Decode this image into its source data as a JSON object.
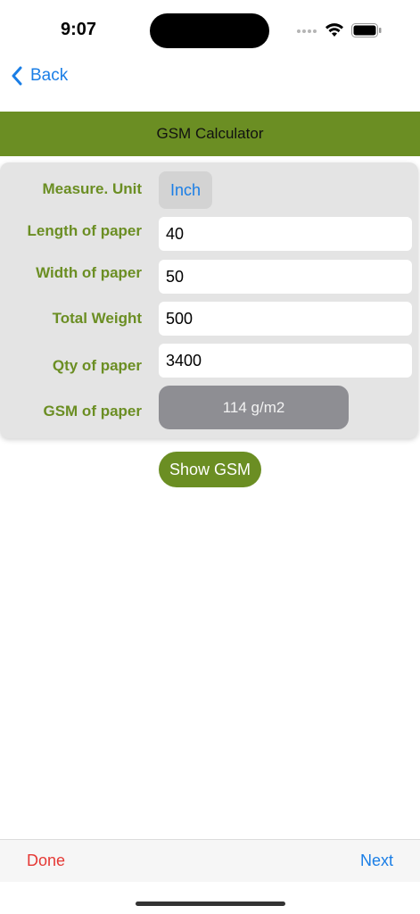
{
  "status_bar": {
    "time": "9:07",
    "icons": [
      "cellular-icon",
      "wifi-icon",
      "battery-icon"
    ]
  },
  "nav": {
    "back_label": "Back",
    "back_icon": "chevron-left-icon"
  },
  "header": {
    "title": "GSM Calculator"
  },
  "form": {
    "unit_label": "Measure. Unit",
    "unit_value": "Inch",
    "length_label": "Length of paper",
    "length_value": "40",
    "width_label": "Width of paper",
    "width_value": "50",
    "weight_label": "Total Weight",
    "weight_value": "500",
    "qty_label": "Qty of paper",
    "qty_value": "3400",
    "gsm_label": "GSM of paper",
    "gsm_value": "114 g/m2"
  },
  "actions": {
    "show_gsm_label": "Show GSM"
  },
  "toolbar": {
    "done_label": "Done",
    "next_label": "Next"
  },
  "colors": {
    "accent_green": "#6b8e23",
    "link_blue": "#1a7ee6",
    "done_red": "#e53935",
    "result_gray": "#8e8e93"
  }
}
